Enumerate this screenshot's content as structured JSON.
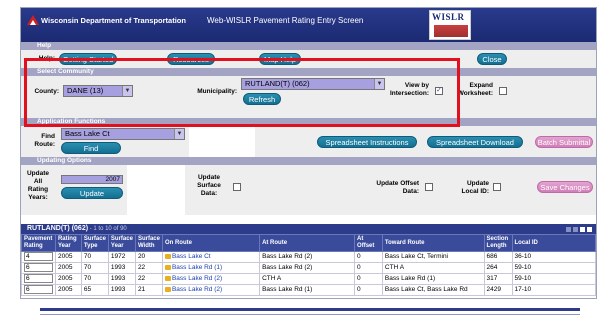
{
  "header": {
    "agency": "Wisconsin Department of Transportation",
    "screen_title": "Web-WISLR Pavement Rating Entry Screen",
    "logo_text": "WISLR"
  },
  "help": {
    "section": "Help",
    "label": "Help:",
    "getting_started": "Getting Started",
    "resources": "Resources",
    "map_help": "Map Help",
    "close": "Close"
  },
  "community": {
    "section": "Select Community",
    "county_label": "County:",
    "county_value": "DANE (13)",
    "municipality_label": "Municipality:",
    "municipality_value": "RUTLAND(T) (062)",
    "refresh": "Refresh",
    "view_by_intersection_label": "View by Intersection:",
    "view_by_intersection_checked": true,
    "view_by_intersection_mark": "✓",
    "expand_worksheet_label": "Expand Worksheet:",
    "expand_worksheet_checked": false
  },
  "app_functions": {
    "section": "Application Functions",
    "find_route_label": "Find Route:",
    "route_value": "Bass Lake Ct",
    "find": "Find",
    "spreadsheet_instructions": "Spreadsheet Instructions",
    "spreadsheet_download": "Spreadsheet Download",
    "batch_submittal": "Batch Submittal"
  },
  "updating": {
    "section": "Updating Options",
    "update_all_label": "Update All Rating Years:",
    "year_value": "2007",
    "update": "Update",
    "update_surface_label": "Update Surface Data:",
    "update_offset_label": "Update Offset Data:",
    "update_local_id_label": "Update Local ID:",
    "save_changes": "Save Changes"
  },
  "table": {
    "title": "RUTLAND(T) (062)",
    "range": " - 1 to 10 of 90",
    "columns": [
      "Pavement Rating",
      "Rating Year",
      "Surface Type",
      "Surface Year",
      "Surface Width",
      "On Route",
      "At Route",
      "At Offset",
      "Toward Route",
      "Section Length",
      "Local ID"
    ],
    "rows": [
      {
        "rating": "4",
        "year": "2005",
        "type": "70",
        "syear": "1972",
        "width": "20",
        "on": "Bass Lake Ct",
        "at": "Bass Lake Rd (2)",
        "offset": "0",
        "toward": "Bass Lake Ct, Termini",
        "length": "686",
        "local": "36-10"
      },
      {
        "rating": "6",
        "year": "2005",
        "type": "70",
        "syear": "1993",
        "width": "22",
        "on": "Bass Lake Rd (1)",
        "at": "Bass Lake Rd (2)",
        "offset": "0",
        "toward": "CTH A",
        "length": "264",
        "local": "59-10"
      },
      {
        "rating": "6",
        "year": "2005",
        "type": "70",
        "syear": "1993",
        "width": "22",
        "on": "Bass Lake Rd (2)",
        "at": "CTH A",
        "offset": "0",
        "toward": "Bass Lake Rd (1)",
        "length": "317",
        "local": "59-10"
      },
      {
        "rating": "6",
        "year": "2005",
        "type": "65",
        "syear": "1993",
        "width": "21",
        "on": "Bass Lake Rd (2)",
        "at": "Bass Lake Rd (1)",
        "offset": "0",
        "toward": "Bass Lake Ct, Bass Lake Rd",
        "length": "2429",
        "local": "17-10"
      }
    ]
  },
  "colors": {
    "header": "#1b2a72",
    "button": "#146f92",
    "highlight": "#e0101e",
    "select": "#a7a0e0"
  }
}
